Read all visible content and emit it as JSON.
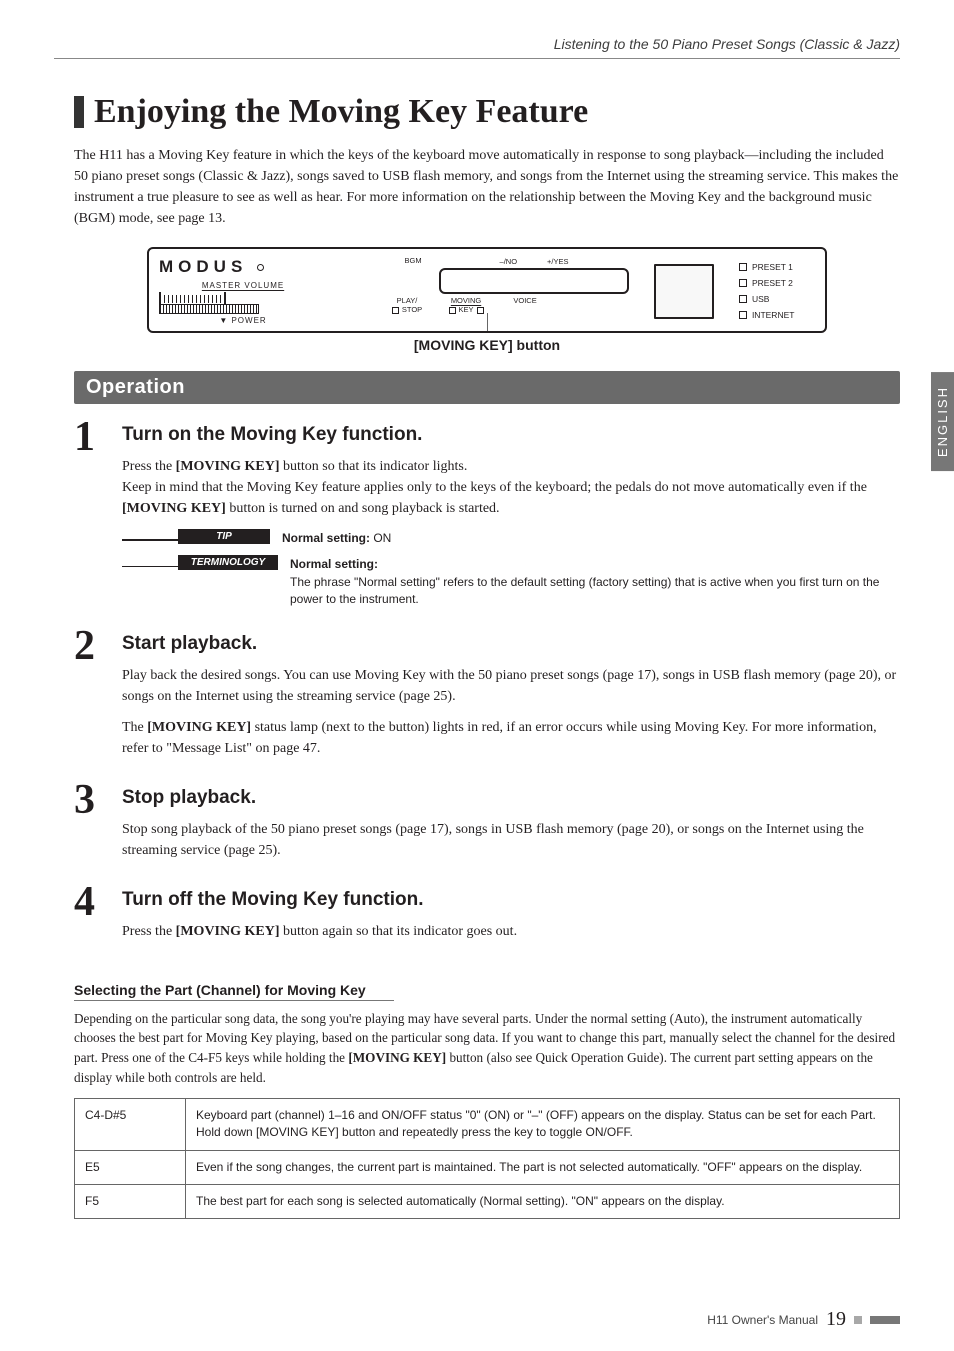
{
  "header": {
    "breadcrumb": "Listening to the 50 Piano Preset Songs (Classic & Jazz)"
  },
  "side_tab": "ENGLISH",
  "title": "Enjoying the Moving Key Feature",
  "intro": "The H11 has a Moving Key feature in which the keys of the keyboard move automatically in response to song playback—including the included 50 piano preset songs (Classic & Jazz), songs saved to USB flash memory, and songs from the Internet using the streaming service. This makes the instrument a true pleasure to see as well as hear. For more information on the relationship between the Moving Key and the background music (BGM) mode, see page 13.",
  "panel": {
    "brand": "MODUS",
    "master_volume": "MASTER VOLUME",
    "power": "▼ POWER",
    "top_labels": {
      "bgm": "BGM",
      "no": "–/NO",
      "yes": "+/YES"
    },
    "bottom_labels": {
      "play": "PLAY/",
      "stop": "STOP",
      "moving": "MOVING",
      "key": "KEY",
      "voice": "VOICE"
    },
    "right": {
      "p1": "PRESET 1",
      "p2": "PRESET 2",
      "usb": "USB",
      "net": "INTERNET"
    }
  },
  "callout": "[MOVING KEY] button",
  "operation_label": "Operation",
  "steps": {
    "s1": {
      "num": "1",
      "title": "Turn on the Moving Key function.",
      "p1a": "Press the ",
      "p1b": "[MOVING KEY]",
      "p1c": " button so that its indicator lights.",
      "p2a": "Keep in mind that the Moving Key feature applies only to the keys of the keyboard; the pedals do not move automatically even if the ",
      "p2b": "[MOVING KEY]",
      "p2c": " button is turned on and song playback is started.",
      "tip_label": "TIP",
      "tip_strong": "Normal setting:",
      "tip_val": " ON",
      "term_label": "TERMINOLOGY",
      "term_strong": "Normal setting:",
      "term_body": "The phrase \"Normal setting\" refers to the default setting (factory setting) that is active when you first turn on the power to the instrument."
    },
    "s2": {
      "num": "2",
      "title": "Start playback.",
      "p1": "Play back the desired songs. You can use Moving Key with the 50 piano preset songs (page 17), songs in USB flash memory (page 20), or songs on the Internet using the streaming service (page 25).",
      "p2a": "The ",
      "p2b": "[MOVING KEY]",
      "p2c": " status lamp (next to the button) lights in red, if an error occurs while using Moving Key. For more information, refer to \"Message List\" on page 47."
    },
    "s3": {
      "num": "3",
      "title": "Stop playback.",
      "p": "Stop song playback of the 50 piano preset songs (page 17), songs in USB flash memory (page 20), or songs on the Internet using the streaming service (page 25)."
    },
    "s4": {
      "num": "4",
      "title": "Turn off the Moving Key function.",
      "pa": "Press the ",
      "pb": "[MOVING KEY]",
      "pc": " button again so that its indicator goes out."
    }
  },
  "subhead": "Selecting the Part (Channel) for Moving Key",
  "subpara_a": "Depending on the particular song data, the song you're playing may have several parts. Under the normal setting (Auto), the instrument automatically chooses the best part for Moving Key playing, based on the particular song data. If you want to change this part, manually select the channel for the desired part. Press one of the C4-F5 keys while holding the ",
  "subpara_b": "[MOVING KEY]",
  "subpara_c": " button (also see Quick Operation Guide). The current part setting appears on the display while both controls are held.",
  "table": {
    "r1": {
      "k": "C4-D#5",
      "v": "Keyboard part (channel) 1–16 and ON/OFF status \"0\" (ON) or \"–\" (OFF) appears on the display. Status can be set for each Part. Hold down [MOVING KEY] button and repeatedly press the key to toggle ON/OFF."
    },
    "r2": {
      "k": "E5",
      "v": "Even if the song changes, the current part is maintained. The part is not selected automatically. \"OFF\" appears on the display."
    },
    "r3": {
      "k": "F5",
      "v": "The best part for each song is selected automatically (Normal setting). \"ON\" appears on the display."
    }
  },
  "footer": {
    "manual": "H11 Owner's Manual",
    "page": "19"
  }
}
